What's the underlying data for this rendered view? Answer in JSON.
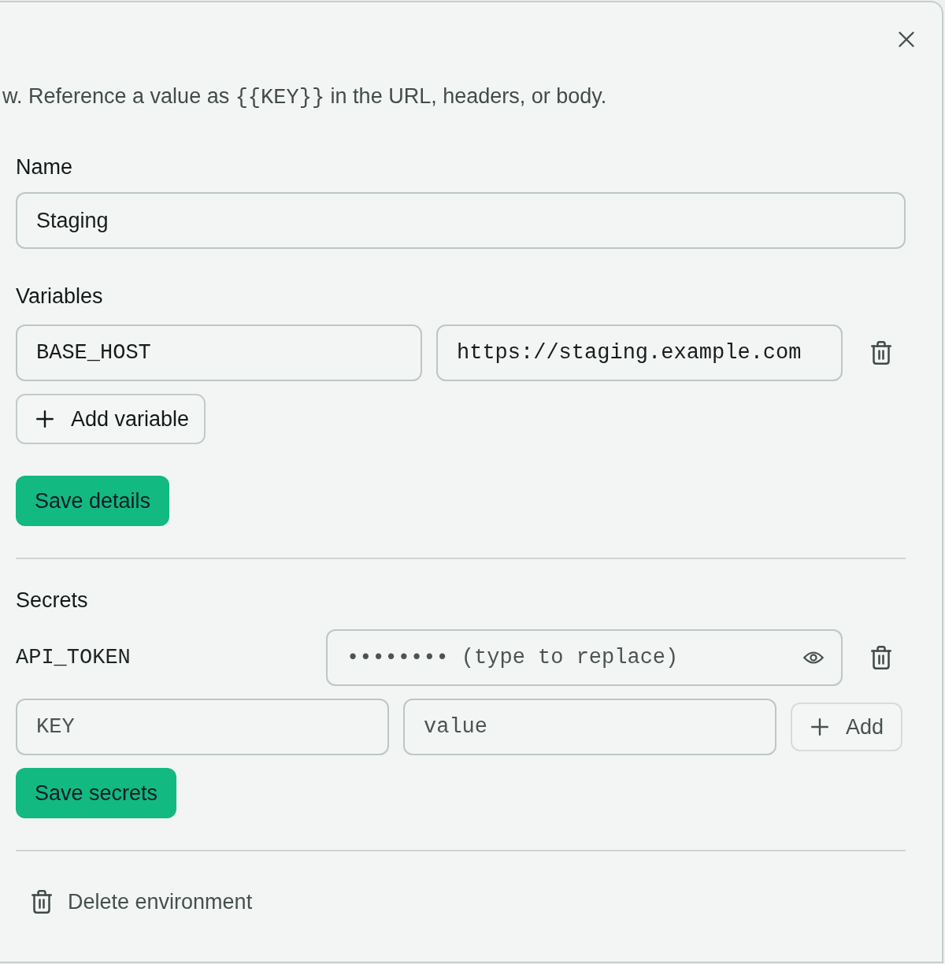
{
  "intro": [
    {
      "kind": "text",
      "text": "w. Reference a value as "
    },
    {
      "kind": "code",
      "text": "{{KEY}}"
    },
    {
      "kind": "text",
      "text": " in the URL, headers, or body."
    }
  ],
  "name_field": {
    "label": "Name",
    "value": "Staging"
  },
  "variables": {
    "label": "Variables",
    "rows": [
      {
        "key": "BASE_HOST",
        "value": "https://staging.example.com"
      }
    ],
    "add_button": "Add variable",
    "save_button": "Save details"
  },
  "secrets": {
    "label": "Secrets",
    "rows": [
      {
        "key": "API_TOKEN",
        "placeholder": "•••••••• (type to replace)"
      }
    ],
    "new_key": {
      "placeholder": "KEY"
    },
    "new_value": {
      "placeholder": "value"
    },
    "add_button": "Add",
    "save_button": "Save secrets"
  },
  "delete_button": "Delete environment"
}
